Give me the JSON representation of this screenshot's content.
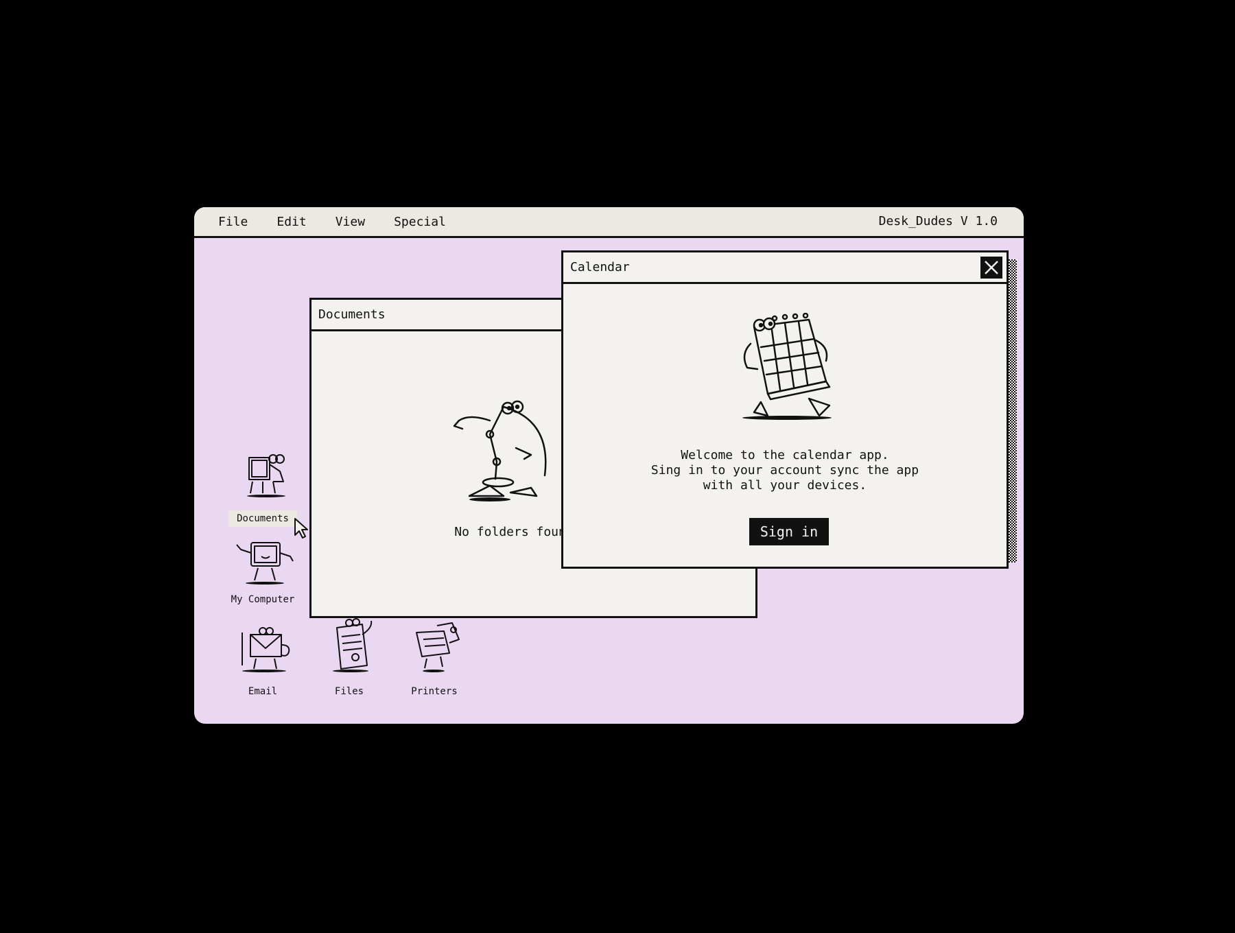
{
  "menubar": {
    "items": [
      "File",
      "Edit",
      "View",
      "Special"
    ],
    "app_title": "Desk_Dudes V 1.0"
  },
  "documents_window": {
    "title": "Documents",
    "empty_message": "No folders found"
  },
  "calendar_window": {
    "title": "Calendar",
    "message_lines": [
      "Welcome to the calendar app.",
      "Sing in to your account sync the app",
      "with all your devices."
    ],
    "signin_label": "Sign in"
  },
  "desktop_icons": [
    {
      "label": "Documents",
      "icon": "documents-dude-icon",
      "selected": true
    },
    {
      "label": "My Computer",
      "icon": "computer-dude-icon"
    },
    {
      "label": "Email",
      "icon": "email-dude-icon"
    },
    {
      "label": "Files",
      "icon": "files-dude-icon"
    },
    {
      "label": "Printers",
      "icon": "printer-dude-icon"
    }
  ],
  "colors": {
    "background": "#000000",
    "desktop": "#ead7f1",
    "window": "#f4f2ee",
    "menubar": "#ece9e3",
    "ink": "#111111"
  }
}
